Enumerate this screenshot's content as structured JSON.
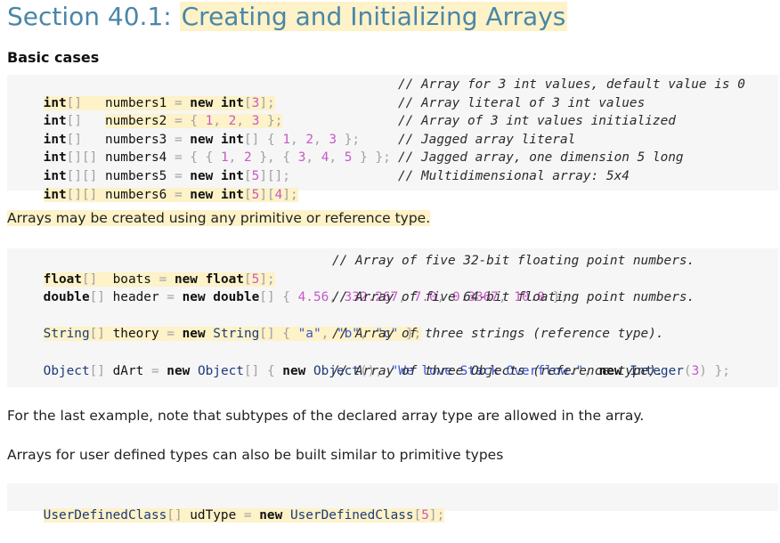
{
  "section": {
    "number": "Section 40.1:",
    "title": "Creating and Initializing Arrays"
  },
  "basic_cases_heading": "Basic cases",
  "code_block_1": [
    {
      "code": "int[]   numbers1 = new int[3];",
      "comment": "// Array for 3 int values, default value is 0"
    },
    {
      "code": "int[]   numbers2 = { 1, 2, 3 };",
      "comment": "// Array literal of 3 int values"
    },
    {
      "code": "int[]   numbers3 = new int[] { 1, 2, 3 };",
      "comment": "// Array of 3 int values initialized"
    },
    {
      "code": "int[][] numbers4 = { { 1, 2 }, { 3, 4, 5 } };",
      "comment": "// Jagged array literal"
    },
    {
      "code": "int[][] numbers5 = new int[5][];",
      "comment": "// Jagged array, one dimension 5 long"
    },
    {
      "code": "int[][] numbers6 = new int[5][4];",
      "comment": "// Multidimensional array: 5x4"
    }
  ],
  "paragraph_1": "Arrays may be created using any primitive or reference type.",
  "code_block_2": [
    {
      "code": "float[]  boats = new float[5];",
      "comment": "// Array of five 32-bit floating point numbers."
    },
    {
      "code": "double[] header = new double[] { 4.56, 332.267, 7.0, 0.3367, 10.0 };",
      "comment": ""
    },
    {
      "code": "",
      "comment": "// Array of five 64-bit floating point numbers."
    },
    {
      "code": "String[] theory = new String[] { \"a\", \"b\", \"c\" };",
      "comment": ""
    },
    {
      "code": "",
      "comment": "// Array of three strings (reference type)."
    },
    {
      "code": "Object[] dArt = new Object[] { new Object(), \"We love Stack Overflow.\", new Integer(3) };",
      "comment": ""
    },
    {
      "code": "",
      "comment": "// Array of three Objects (reference type)."
    }
  ],
  "paragraph_2": "For the last example, note that subtypes of the declared array type are allowed in the array.",
  "paragraph_3": "Arrays for user defined types can also be built similar to primitive types",
  "code_block_3": [
    {
      "code": "UserDefinedClass[] udType = new UserDefinedClass[5];",
      "comment": ""
    }
  ],
  "colors": {
    "heading": "#4a86a8",
    "highlight": "#fdf2c8",
    "code_bg": "#f6f6f6",
    "number": "#c45ac4",
    "string": "#3a55cc"
  }
}
